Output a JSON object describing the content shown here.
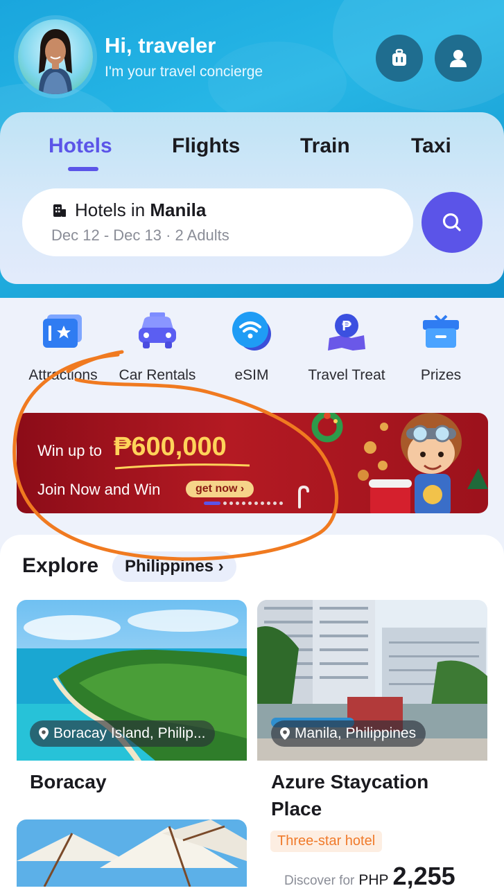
{
  "header": {
    "greeting": "Hi, traveler",
    "subtitle": "I'm your travel concierge",
    "icons": [
      "luggage-icon",
      "profile-icon"
    ]
  },
  "tabs": [
    {
      "label": "Hotels",
      "active": true
    },
    {
      "label": "Flights",
      "active": false
    },
    {
      "label": "Train",
      "active": false
    },
    {
      "label": "Taxi",
      "active": false
    }
  ],
  "search": {
    "prefix": "Hotels in ",
    "city": "Manila",
    "details": "Dec 12 - Dec 13 · 2 Adults"
  },
  "quick_links": [
    {
      "label": "Attractions",
      "icon": "attractions-icon"
    },
    {
      "label": "Car Rentals",
      "icon": "car-icon"
    },
    {
      "label": "eSIM",
      "icon": "esim-icon"
    },
    {
      "label": "Travel Treat",
      "icon": "travel-treat-icon"
    },
    {
      "label": "Prizes",
      "icon": "prizes-icon"
    }
  ],
  "banner": {
    "prefix": "Win up to",
    "amount": "₱600,000",
    "line2": "Join Now and Win",
    "cta": "get now ›",
    "slides_total": 12,
    "active_slide": 1
  },
  "explore": {
    "title": "Explore",
    "country": "Philippines ›",
    "cards": [
      {
        "location": "Boracay Island, Philip...",
        "title": "Boracay"
      },
      {
        "location": "Manila, Philippines",
        "title_line1": "Azure Staycation",
        "title_line2": "Place",
        "badge": "Three-star hotel",
        "price_prefix": "Discover for",
        "currency": "PHP",
        "price": "2,255"
      }
    ]
  },
  "colors": {
    "accent": "#5b54e8",
    "annotation": "#f07a20",
    "badge_text": "#f07a2a"
  }
}
